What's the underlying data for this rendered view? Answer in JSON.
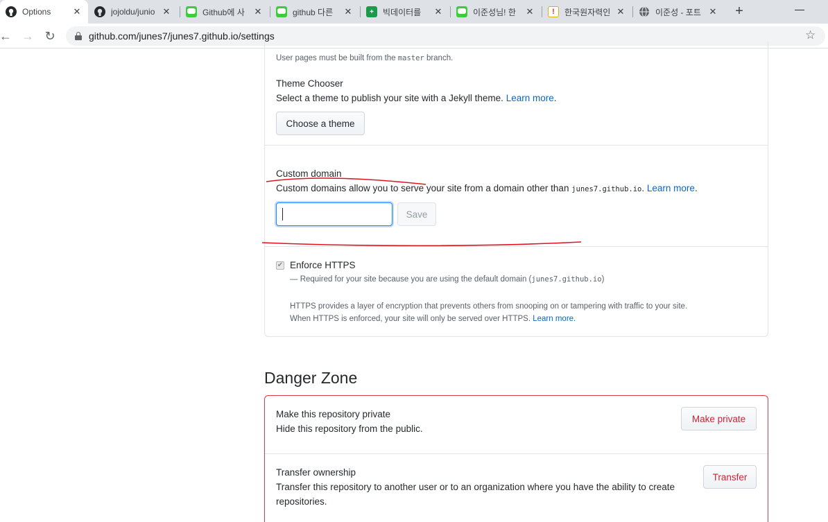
{
  "browser": {
    "tabs": [
      {
        "title": "Options",
        "favicon": "github-icon",
        "color": "#24292e",
        "glyph": "",
        "active": true
      },
      {
        "title": "jojoldu/junio",
        "favicon": "github-icon",
        "color": "#24292e",
        "glyph": "",
        "active": false
      },
      {
        "title": "Github에 사",
        "favicon": "line-icon",
        "color": "#3ccc3c",
        "glyph": "",
        "active": false
      },
      {
        "title": "github 다른",
        "favicon": "line-icon",
        "color": "#3ccc3c",
        "glyph": "",
        "active": false
      },
      {
        "title": "빅데이터를",
        "favicon": "sheets-icon",
        "color": "#1a9a4a",
        "glyph": "+",
        "active": false
      },
      {
        "title": "이준성님! 한",
        "favicon": "line-icon",
        "color": "#3ccc3c",
        "glyph": "",
        "active": false
      },
      {
        "title": "한국원자력인",
        "favicon": "kakao-icon",
        "color": "#f0c000",
        "glyph": "!",
        "active": false
      },
      {
        "title": "이준성 - 포트",
        "favicon": "globe-icon",
        "color": "#5f6368",
        "glyph": "",
        "active": false
      }
    ],
    "url": "github.com/junes7/junes7.github.io/settings"
  },
  "pages": {
    "note_prefix": "User pages must be built from the",
    "note_branch": "master",
    "note_suffix": "branch."
  },
  "theme": {
    "title": "Theme Chooser",
    "desc": "Select a theme to publish your site with a Jekyll theme.",
    "learn_more": "Learn more",
    "button": "Choose a theme"
  },
  "custom_domain": {
    "title": "Custom domain",
    "desc": "Custom domains allow you to serve your site from a domain other than",
    "domain": "junes7.github.io",
    "learn_more": "Learn more",
    "value": "",
    "save": "Save"
  },
  "https": {
    "label": "Enforce HTTPS",
    "checked": true,
    "required_prefix": "— Required for your site because you are using the default domain (",
    "required_domain": "junes7.github.io",
    "required_suffix": ")",
    "info_line1": "HTTPS provides a layer of encryption that prevents others from snooping on or tampering with traffic to your site.",
    "info_line2": "When HTTPS is enforced, your site will only be served over HTTPS.",
    "learn_more": "Learn more."
  },
  "danger": {
    "title": "Danger Zone",
    "private_title": "Make this repository private",
    "private_desc": "Hide this repository from the public.",
    "private_button": "Make private",
    "transfer_title": "Transfer ownership",
    "transfer_desc_line1": "Transfer this repository to another user or to an organization where you have the ability to create",
    "transfer_desc_line2": "repositories.",
    "transfer_button": "Transfer"
  },
  "colors": {
    "link": "#0366d6",
    "danger": "#cb2431",
    "annotation": "#e0141e"
  }
}
